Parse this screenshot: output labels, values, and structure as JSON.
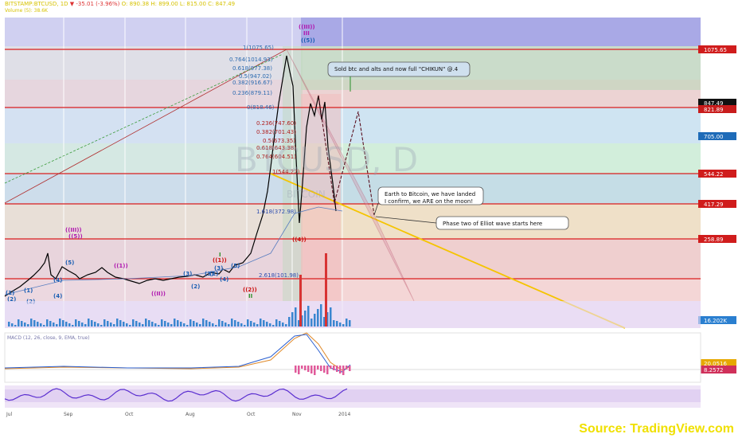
{
  "header": {
    "symbol": "BITSTAMP:BTCUSD, 1D",
    "change": "▼ -35.01 (-3.96%)",
    "open": "O: 890.38",
    "high": "H: 899.00",
    "low": "L: 815.00",
    "close": "C: 847.49",
    "volume": "Volume (5): 38.6K"
  },
  "chart_data": {
    "type": "line",
    "price_axis_labels": [
      "1075.65",
      "847.49",
      "821.89",
      "705.00",
      "544.22",
      "417.29",
      "258.89",
      "16.202K",
      "20.0516",
      "8.2572"
    ],
    "colors": {
      "price": "#000000",
      "fib_red": "#d91e1e",
      "trend_yellow": "#f5c400",
      "accent": "#2a8f2a"
    },
    "fib_labels": [
      "1(1075.65)",
      "0.764(1014.93)",
      "0.618(977.38)",
      "0.5(947.02)",
      "0.382(916.67)",
      "0.236(879.11)",
      "0(818.46)",
      "0.236(747.60)",
      "0.382(701.43)",
      "0.5(673.35)",
      "0.618(643.38)",
      "0.764(604.51)",
      "1(544.22)",
      "1.618(372.98)",
      "2.618(101.98)"
    ],
    "wave_labels": [
      "((III))",
      "III",
      "((5))",
      "((III))",
      "((5))",
      "((1))",
      "((1))",
      "((II))",
      "((2))",
      "((4))",
      "(5)",
      "(5)",
      "(4)",
      "(3)",
      "(4)",
      "(2)",
      "(1)",
      "(2)",
      "(3)",
      "(4)",
      "(1)",
      "(2)",
      "I",
      "II",
      "(1)",
      "(3)"
    ],
    "annotations": [
      "Sold btc and alts and now full \"CHIKUN\" @.4",
      "Earth to Bitcoin, we have landed\nI confirm, we ARE on the moon!",
      "Phase two of Elliot wave starts here"
    ],
    "watermark": "BTCUSD, D",
    "watermark_sub": "BITCOIN",
    "indicators": [
      "MACD (12, 26, close, 9, EMA, true)"
    ],
    "x_tick_labels": [
      "Jul",
      "Sep",
      "Oct",
      "Aug",
      "Oct",
      "Nov",
      "2014"
    ]
  },
  "source": "Source: TradingView.com"
}
